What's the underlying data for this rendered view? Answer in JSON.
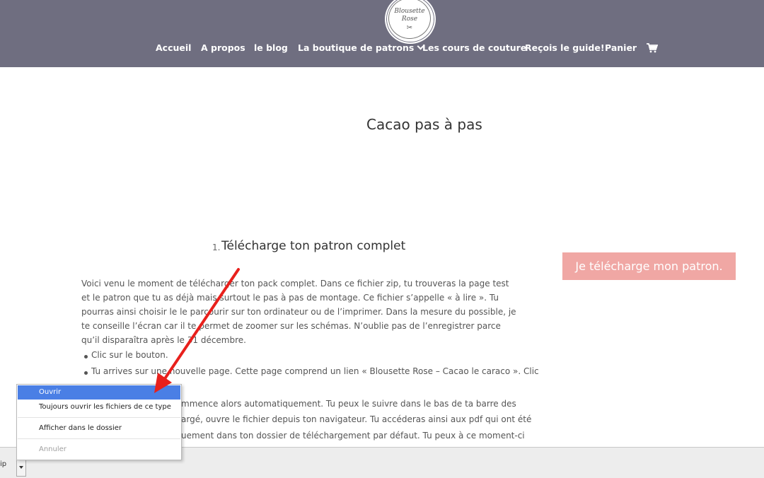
{
  "logo": {
    "line1": "Blousette",
    "line2": "Rose",
    "scissors": "✂"
  },
  "nav": {
    "items": [
      {
        "label": "Accueil"
      },
      {
        "label": "A propos"
      },
      {
        "label": "le blog"
      },
      {
        "label": "La boutique de patrons"
      },
      {
        "label": "Les cours de couture"
      },
      {
        "label": "Reçois le guide!"
      },
      {
        "label": "Panier"
      }
    ],
    "cart_icon": "shopping-cart-icon"
  },
  "main": {
    "title": "Cacao pas à pas",
    "step_number": "1.",
    "step_title": "Télécharge ton patron complet",
    "download_button": "Je télécharge mon patron.",
    "paragraph": "Voici venu le moment de télécharger ton pack complet. Dans ce fichier zip, tu trouveras la page test et le patron que tu as déjà mais surtout le pas à pas de montage. Ce fichier s’appelle « à lire ». Tu pourras ainsi choisir le le parcourir sur ton ordinateur ou de l’imprimer. Dans la mesure du possible, je te conseille l’écran car il te permet de zoomer sur les schémas. N’oublie pas de l’enregistrer parce qu’il disparaîtra après le 31 décembre.",
    "bullets": [
      "Clic sur le bouton.",
      "Tu arrives sur une nouvelle page. Cette page comprend un lien « Blousette Rose – Cacao le caraco ». Clic"
    ],
    "partial_lines": [
      "mmence alors automatiquement. Tu peux le suivre dans le bas de ta barre des",
      "argé, ouvre le fichier depuis ton navigateur. Tu accéderas ainsi aux pdf qui ont été",
      "uement dans ton dossier de téléchargement par défaut. Tu peux à ce moment-ci"
    ]
  },
  "context_menu": {
    "items": [
      {
        "label": "Ouvrir"
      },
      {
        "label": "Toujours ouvrir les fichiers de ce type"
      },
      {
        "label": "Afficher dans le dossier"
      },
      {
        "label": "Annuler"
      }
    ]
  },
  "download_bar": {
    "file_label": "ip"
  },
  "colors": {
    "header": "#6f6e80",
    "button": "#f0a7a4",
    "menu_highlight": "#4a7fe5",
    "arrow": "#e8201c"
  }
}
